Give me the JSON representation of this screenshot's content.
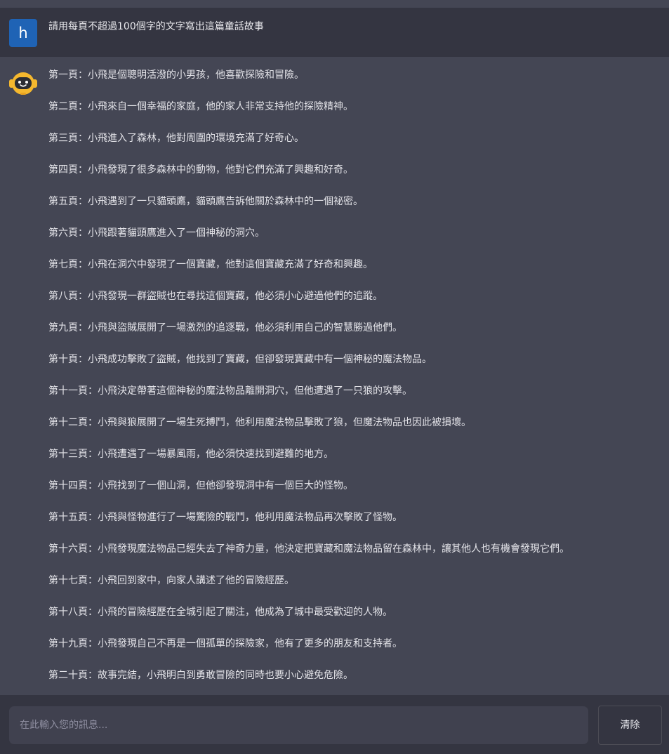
{
  "user_message": {
    "avatar_letter": "h",
    "text": "請用每頁不超過100個字的文字寫出這篇童話故事"
  },
  "bot_message": {
    "avatar_icon": "robot-face-icon",
    "paragraphs": [
      "第一頁：小飛是個聰明活潑的小男孩，他喜歡探險和冒險。",
      "第二頁：小飛來自一個幸福的家庭，他的家人非常支持他的探險精神。",
      "第三頁：小飛進入了森林，他對周圍的環境充滿了好奇心。",
      "第四頁：小飛發現了很多森林中的動物，他對它們充滿了興趣和好奇。",
      "第五頁：小飛遇到了一只貓頭鷹，貓頭鷹告訴他關於森林中的一個祕密。",
      "第六頁：小飛跟著貓頭鷹進入了一個神秘的洞穴。",
      "第七頁：小飛在洞穴中發現了一個寶藏，他對這個寶藏充滿了好奇和興趣。",
      "第八頁：小飛發現一群盜賊也在尋找這個寶藏，他必須小心避過他們的追蹤。",
      "第九頁：小飛與盜賊展開了一場激烈的追逐戰，他必須利用自己的智慧勝過他們。",
      "第十頁：小飛成功擊敗了盜賊，他找到了寶藏，但卻發現寶藏中有一個神秘的魔法物品。",
      "第十一頁：小飛決定帶著這個神秘的魔法物品離開洞穴，但他遭遇了一只狼的攻擊。",
      "第十二頁：小飛與狼展開了一場生死搏鬥，他利用魔法物品擊敗了狼，但魔法物品也因此被損壞。",
      "第十三頁：小飛遭遇了一場暴風雨，他必須快速找到避難的地方。",
      "第十四頁：小飛找到了一個山洞，但他卻發現洞中有一個巨大的怪物。",
      "第十五頁：小飛與怪物進行了一場驚險的戰鬥，他利用魔法物品再次擊敗了怪物。",
      "第十六頁：小飛發現魔法物品已經失去了神奇力量，他決定把寶藏和魔法物品留在森林中，讓其他人也有機會發現它們。",
      "第十七頁：小飛回到家中，向家人講述了他的冒險經歷。",
      "第十八頁：小飛的冒險經歷在全城引起了關注，他成為了城中最受歡迎的人物。",
      "第十九頁：小飛發現自己不再是一個孤單的探險家，他有了更多的朋友和支持者。",
      "第二十頁：故事完結，小飛明白到勇敢冒險的同時也要小心避免危險。"
    ]
  },
  "composer": {
    "placeholder": "在此輸入您的訊息...",
    "clear_label": "清除"
  },
  "colors": {
    "user_row_bg": "#343541",
    "bot_row_bg": "#444654",
    "user_avatar_bg": "#1f63b5",
    "bot_avatar_yellow": "#f5b82e"
  }
}
